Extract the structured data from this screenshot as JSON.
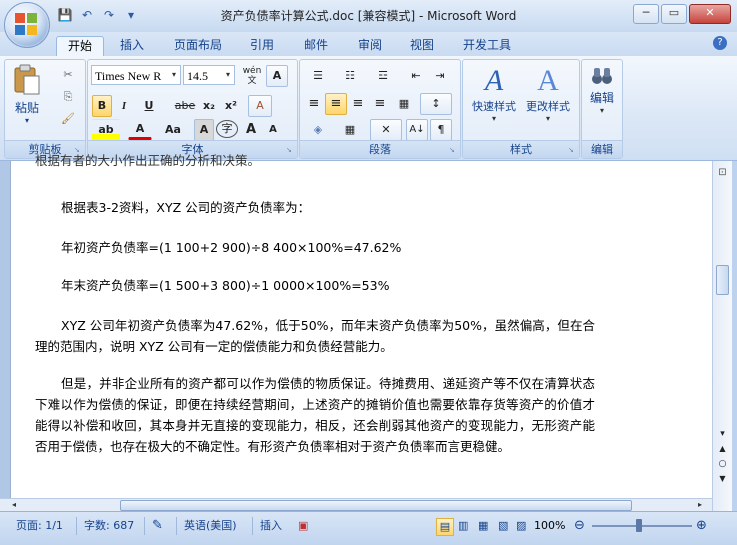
{
  "window": {
    "title": "资产负债率计算公式.doc [兼容模式] - Microsoft Word",
    "minimize": "─",
    "maximize": "▭",
    "close": "✕"
  },
  "qat": {
    "save": "💾",
    "undo": "↶",
    "redo": "↷",
    "customize": "▾"
  },
  "tabs": [
    {
      "label": "开始",
      "active": true
    },
    {
      "label": "插入"
    },
    {
      "label": "页面布局"
    },
    {
      "label": "引用"
    },
    {
      "label": "邮件"
    },
    {
      "label": "审阅"
    },
    {
      "label": "视图"
    },
    {
      "label": "开发工具"
    }
  ],
  "help_label": "?",
  "ribbon": {
    "clipboard": {
      "label": "剪贴板",
      "paste_label": "粘贴",
      "paste_arrow": "▾",
      "cut": "✂",
      "copy": "⎘",
      "format_painter": "🖌"
    },
    "font": {
      "label": "字体",
      "font_name": "Times New R",
      "font_size": "14.5",
      "phonetic": "wén",
      "phonetic_char": "文",
      "char_border": "A",
      "bold": "B",
      "italic": "I",
      "underline": "U",
      "strike": "abe",
      "subscript": "x₂",
      "superscript": "x²",
      "clear_format": "A",
      "highlight": "ab",
      "font_color": "A",
      "change_case": "Aa",
      "char_shading": "A",
      "enclose": "字",
      "grow": "A",
      "shrink": "A"
    },
    "paragraph": {
      "label": "段落",
      "bullets": "☰",
      "numbering": "☷",
      "multilevel": "☲",
      "decrease_indent": "⇤",
      "increase_indent": "⇥",
      "align_left": "≡",
      "align_center": "≡",
      "align_right": "≡",
      "justify": "≡",
      "distributed": "▦",
      "line_spacing": "↕",
      "shading": "◈",
      "borders": "▦",
      "asian_layout": "✕",
      "sort": "A↓",
      "show_marks": "¶"
    },
    "styles": {
      "label": "样式",
      "quick_styles": "快速样式",
      "change_styles": "更改样式",
      "quick_arrow": "▾",
      "change_arrow": "▾"
    },
    "editing": {
      "label": "编辑",
      "editing_label": "编辑",
      "arrow": "▾"
    }
  },
  "document": {
    "cut_top_line": "根据有者的大小作出正确的分析和决策。",
    "p1": "根据表3-2资料，XYZ 公司的资产负债率为：",
    "p2": "年初资产负债率=(1 100+2 900)÷8 400×100%=47.62%",
    "p3": "年末资产负债率=(1 500+3 800)÷1 0000×100%=53%",
    "p4": "XYZ 公司年初资产负债率为47.62%，低于50%，而年末资产负债率为50%，虽然偏高，但在合理的范围内，说明 XYZ 公司有一定的偿债能力和负债经营能力。",
    "p5": "但是，并非企业所有的资产都可以作为偿债的物质保证。待摊费用、递延资产等不仅在清算状态下难以作为偿债的保证，即便在持续经营期间，上述资产的摊销价值也需要依靠存货等资产的价值才能得以补偿和收回，其本身并无直接的变现能力，相反，还会削弱其他资产的变现能力，无形资产能否用于偿债，也存在极大的不确定性。有形资产负债率相对于资产负债率而言更稳健。"
  },
  "statusbar": {
    "page": "页面: 1/1",
    "words": "字数: 687",
    "language": "英语(美国)",
    "insert": "插入",
    "zoom": "100%",
    "zoom_minus": "⊖",
    "zoom_plus": "⊕"
  }
}
